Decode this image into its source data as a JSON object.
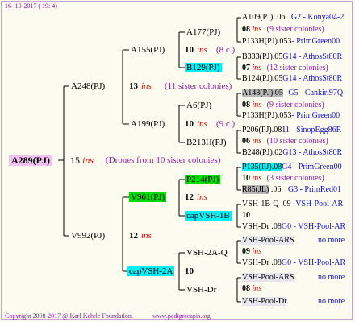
{
  "header": {
    "date": "16- 10-2017 ( 19: 4)"
  },
  "footer": {
    "copyright": "Copyright 2008-2017 @ Karl Kehrle Foundation.",
    "site": "www.pedigreeapis.org"
  },
  "root": {
    "id": "A289(PJ)",
    "num": "15",
    "ins": "ins",
    "note": "(Drones from 10 sister colonies)"
  },
  "gen1": {
    "top": {
      "id": "A248(PJ)",
      "num": "13",
      "ins": "ins",
      "note": "(11 sister colonies)"
    },
    "bottom": {
      "id": "V992(PJ)",
      "num": "12",
      "ins": "ins"
    }
  },
  "gen2": {
    "a155": {
      "id": "A155(PJ)",
      "num": "10",
      "ins": "ins",
      "note": "(8 c.)"
    },
    "a199": {
      "id": "A199(PJ)",
      "num": "10",
      "ins": "ins",
      "note": "(9 c.)"
    },
    "v961": {
      "id": "V961(PJ)",
      "num": "12",
      "ins": "ins"
    },
    "capvsh2a": {
      "id": "capVSH-2A",
      "num": "10"
    }
  },
  "gen3": {
    "a177": {
      "id": "A177(PJ)"
    },
    "b129": {
      "id": "B129(PJ)"
    },
    "a6": {
      "id": "A6(PJ)"
    },
    "b213h": {
      "id": "B213H(PJ)"
    },
    "p214": {
      "id": "P214(PJ)"
    },
    "capvsh1b": {
      "id": "capVSH-1B"
    },
    "vsh2aq": {
      "id": "VSH-2A-Q"
    },
    "vshdr": {
      "id": "VSH-Dr"
    }
  },
  "gen4": [
    {
      "id": "A109(PJ)",
      "code": ".06",
      "place": "G2 - Konya04-2"
    },
    {
      "id": "08",
      "ins": "ins",
      "note": "(9 sister colonies)"
    },
    {
      "id": "P133H(PJ)",
      "code": ".053",
      "place": "- PrimGreen00"
    },
    {
      "id": "B333(PJ)",
      "code": ".05",
      "place": "G14 - AthosSt80R"
    },
    {
      "id": "07",
      "ins": "ins",
      "note": "(12 sister colonies)"
    },
    {
      "id": "B124(PJ)",
      "code": ".05",
      "place": "G14 - AthosSt80R"
    },
    {
      "id": "A148(PJ)",
      "code": ".05",
      "place": "G5 - Cankiri97Q"
    },
    {
      "id": "08",
      "ins": "ins",
      "note": "(9 sister colonies)"
    },
    {
      "id": "P133H(PJ)",
      "code": ".053",
      "place": "- PrimGreen00"
    },
    {
      "id": "P206(PJ)",
      "code": ".081",
      "place": "1 - SinopEgg86R"
    },
    {
      "id": "06",
      "ins": "ins",
      "note": "(10 sister colonies)"
    },
    {
      "id": "B248(PJ)",
      "code": ".02",
      "place": "G13 - AthosSt80R"
    },
    {
      "id": "P135(PJ)",
      "code": ".08",
      "place": "G4 - PrimGreen00"
    },
    {
      "id": "10",
      "ins": "ins",
      "note": "(3 sister colonies)"
    },
    {
      "id": "R85(JL)",
      "code": ".06",
      "place": "G3 - PrimRed01"
    },
    {
      "id": "VSH-1B-Q",
      "code": ".09",
      "place": "- VSH-Pool-AR"
    },
    {
      "id": "10",
      "ins": "",
      "note": ""
    },
    {
      "id": "VSH-Dr",
      "code": ".08",
      "place": "G0 - VSH-Pool-AR"
    },
    {
      "id": "VSH-Pool-ARS",
      "code": ".",
      "place": "no more"
    },
    {
      "id": "09",
      "ins": "ins",
      "note": ""
    },
    {
      "id": "VSH-Dr",
      "code": ".08",
      "place": "G0 - VSH-Pool-AR"
    },
    {
      "id": "VSH-Pool-ARS",
      "code": ".",
      "place": "no more"
    },
    {
      "id": "08",
      "ins": "ins",
      "note": ""
    },
    {
      "id": "VSH-Pool-Dr",
      "code": ".",
      "place": "no more"
    }
  ]
}
